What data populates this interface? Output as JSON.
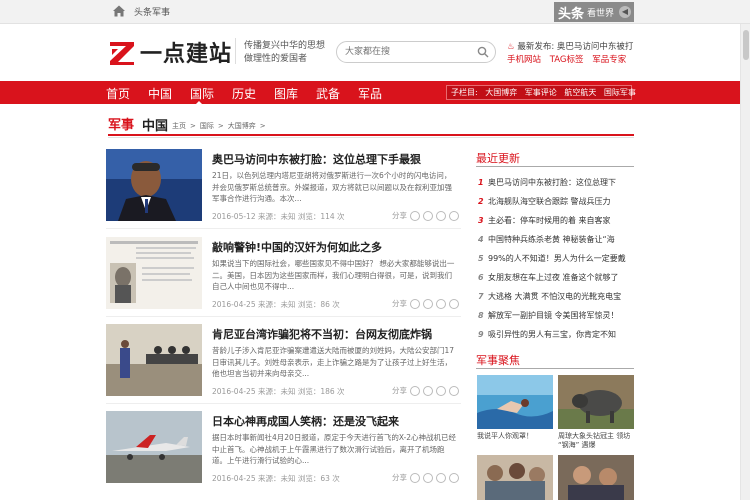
{
  "topbar": {
    "link": "头条军事",
    "brand_main": "头条",
    "brand_sub": "看世界"
  },
  "header": {
    "logo_text": "一点建站",
    "slogan_line1": "传播复兴中华的思想",
    "slogan_line2": "做理性的爱国者",
    "search_placeholder": "大家都在搜",
    "latest_label": "最新发布:",
    "latest_title": "奥巴马访问中东被打",
    "quick_links": [
      "手机网站",
      "TAG标签",
      "军品专家"
    ]
  },
  "nav": {
    "items": [
      "首页",
      "中国",
      "国际",
      "历史",
      "图库",
      "武备",
      "军品"
    ],
    "active": "国际",
    "sub_label": "子栏目:",
    "sub_items": [
      "大国博弈",
      "军事评论",
      "航空航天",
      "国际军事"
    ]
  },
  "section": {
    "badge": "军事",
    "name": "中国",
    "breadcrumb": [
      "主页",
      ">",
      "国际",
      ">",
      "大国博弈",
      ">"
    ]
  },
  "articles": [
    {
      "title": "奥巴马访问中东被打脸：这位总理下手最狠",
      "desc": "21日，以色列总理内塔尼亚胡将对俄罗斯进行一次6个小时的闪电访问，并会见俄罗斯总统普京。外媒报道，双方将就已以间题以及在叙利亚加强军事合作进行沟通。本次...",
      "meta": "2016-05-12 来源：未知 浏览：114 次",
      "share": "分享"
    },
    {
      "title": "敲响警钟!中国的汉奸为何如此之多",
      "desc": "如果说当下的国际社会，哪些国家见不得中国好？ 想必大家都能够说出一二。美国，日本因为这些国家而样，我们心理明白得很，可是，说到我们自己人中间也见不得中...",
      "meta": "2016-04-25 来源：未知 浏览：86 次",
      "share": "分享"
    },
    {
      "title": "肯尼亚台湾诈骗犯将不当初：台网友彻底炸锅",
      "desc": "昔龄儿子涉入肯尼亚诈骗案遭遣送大陆而被厦的刘姓妈，大陆公安部门17日审讯其儿子。刘姓母亲表示，走上诈骗之路是为了让孩子过上好生活，他也坦言当初并来向母亲交...",
      "meta": "2016-04-25 来源：未知 浏览：186 次",
      "share": "分享"
    },
    {
      "title": "日本心神再成国人笑柄：还是没飞起来",
      "desc": "据日本时事新闻社4月20日报道，原定于今天进行首飞的X-2心神战机已经中止首飞。心神战机于上午霞黑进行了数次滑行试验后，离开了机场跑道。上午进行滑行试验的心...",
      "meta": "2016-04-25 来源：未知 浏览：63 次",
      "share": "分享"
    }
  ],
  "sidebar": {
    "latest_title": "最近更新",
    "latest_items": [
      "奥巴马访问中东被打脸：这位总理下",
      "北海舰队海空联合跟踪 警战兵压力",
      "主必看：停车时候用的着 来自客家",
      "中国特种兵练杀老黄 神秘装备让“海",
      "99%的人不知道！男人为什么一定要戴",
      "女朋友想在车上过夜 准备这个就够了",
      "大逃格 大满贯 不怕汉电的光靴充电宝",
      "解放军一副护目镜 令美国将军惊灵！",
      "吸引异性的男人有三宝，你肯定不知"
    ],
    "photo_title": "军事聚焦",
    "photos": [
      "我说平人你观罩！",
      "周琼大象头钻冠主 领坊 “钢海” 遇爆"
    ]
  },
  "colors": {
    "accent": "#d9131c"
  }
}
